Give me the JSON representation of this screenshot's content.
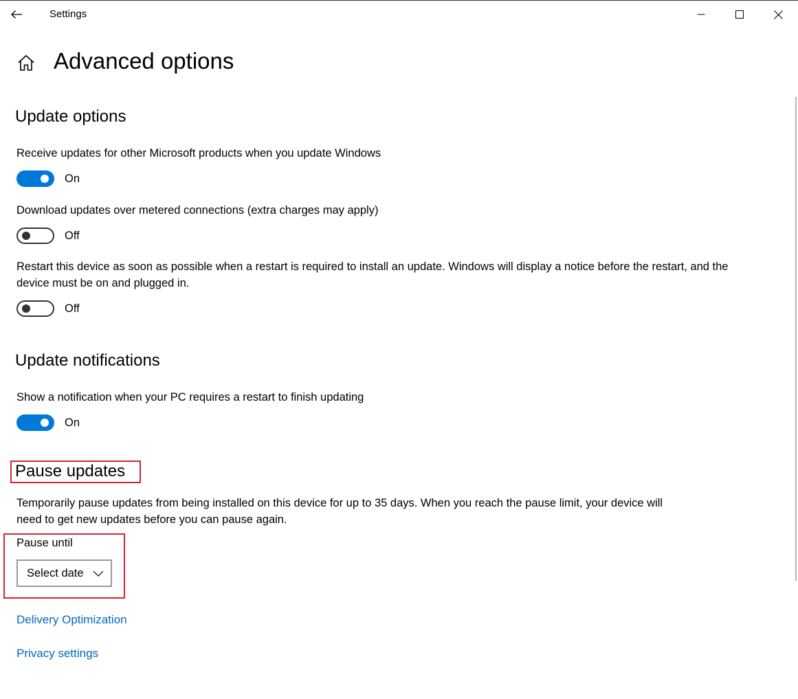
{
  "window": {
    "app_title": "Settings",
    "icons": {
      "back": "back-arrow-icon",
      "minimize": "minimize-icon",
      "maximize": "maximize-icon",
      "close": "close-icon",
      "home": "home-icon"
    }
  },
  "page": {
    "title": "Advanced options"
  },
  "update_options": {
    "heading": "Update options",
    "settings": [
      {
        "label": "Receive updates for other Microsoft products when you update Windows",
        "state": "On",
        "on": true
      },
      {
        "label": "Download updates over metered connections (extra charges may apply)",
        "state": "Off",
        "on": false
      },
      {
        "label_line1": "Restart this device as soon as possible when a restart is required to install an update. Windows will display a notice before the restart, and the",
        "label_line2": "device must be on and plugged in.",
        "state": "Off",
        "on": false
      }
    ]
  },
  "update_notifications": {
    "heading": "Update notifications",
    "label": "Show a notification when your PC requires a restart to finish updating",
    "state": "On",
    "on": true
  },
  "pause_updates": {
    "heading": "Pause updates",
    "description_line1": "Temporarily pause updates from being installed on this device for up to 35 days. When you reach the pause limit, your device will",
    "description_line2": "need to get new updates before you can pause again.",
    "pause_until_label": "Pause until",
    "select_value": "Select date"
  },
  "links": {
    "delivery_optimization": "Delivery Optimization",
    "privacy_settings": "Privacy settings"
  },
  "colors": {
    "accent": "#0078d7",
    "link": "#0067c0",
    "highlight": "#d9232e"
  }
}
